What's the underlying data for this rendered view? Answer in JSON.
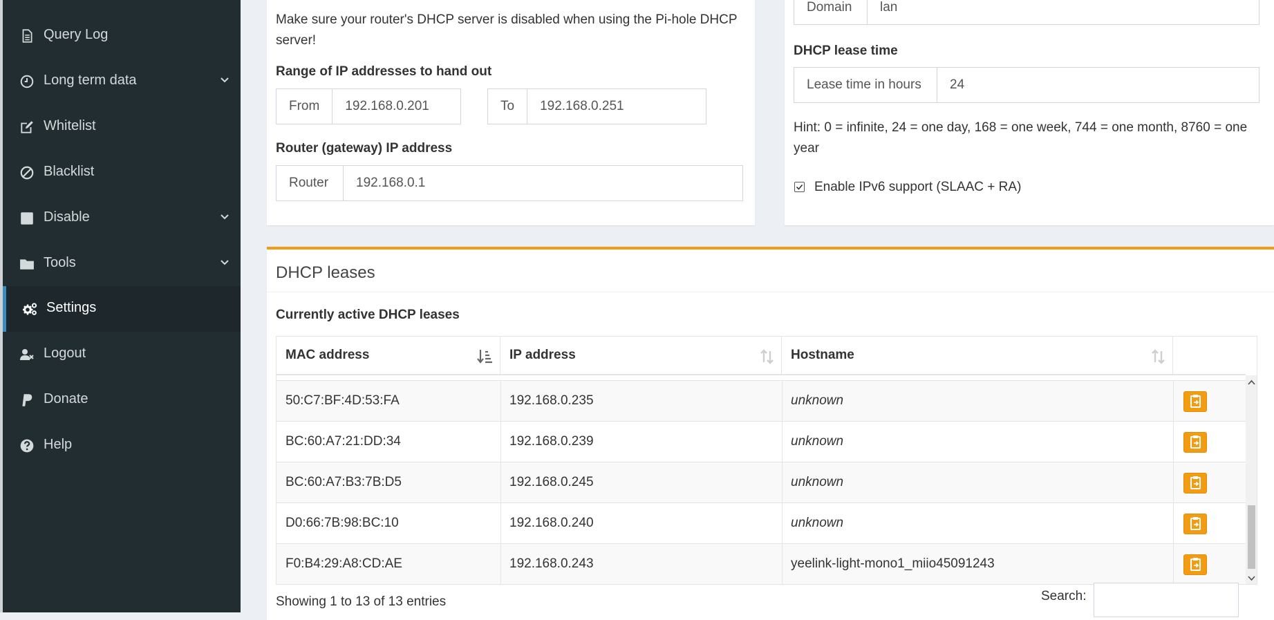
{
  "sidebar": {
    "items": [
      {
        "label": "Query Log",
        "icon": "file-text-icon",
        "active": false,
        "has_chevron": false
      },
      {
        "label": "Long term data",
        "icon": "clock-icon",
        "active": false,
        "has_chevron": true
      },
      {
        "label": "Whitelist",
        "icon": "edit-icon",
        "active": false,
        "has_chevron": false
      },
      {
        "label": "Blacklist",
        "icon": "ban-icon",
        "active": false,
        "has_chevron": false
      },
      {
        "label": "Disable",
        "icon": "stop-icon",
        "active": false,
        "has_chevron": true
      },
      {
        "label": "Tools",
        "icon": "folder-icon",
        "active": false,
        "has_chevron": true
      },
      {
        "label": "Settings",
        "icon": "gears-icon",
        "active": true,
        "has_chevron": false
      },
      {
        "label": "Logout",
        "icon": "user-times-icon",
        "active": false,
        "has_chevron": false
      },
      {
        "label": "Donate",
        "icon": "paypal-icon",
        "active": false,
        "has_chevron": false
      },
      {
        "label": "Help",
        "icon": "question-circle-icon",
        "active": false,
        "has_chevron": false
      }
    ]
  },
  "dhcp_settings": {
    "warning_line1": "Make sure your router's DHCP server is disabled when using the Pi-hole DHCP",
    "warning_line2": "server!",
    "range_heading": "Range of IP addresses to hand out",
    "from_label": "From",
    "from_value": "192.168.0.201",
    "to_label": "To",
    "to_value": "192.168.0.251",
    "router_heading": "Router (gateway) IP address",
    "router_label": "Router",
    "router_value": "192.168.0.1"
  },
  "dhcp_advanced": {
    "domain_label": "Domain",
    "domain_value": "lan",
    "lease_heading": "DHCP lease time",
    "lease_label": "Lease time in hours",
    "lease_value": "24",
    "hint_line1": "Hint: 0 = infinite, 24 = one day, 168 = one week, 744 = one month, 8760 = one",
    "hint_line2": "year",
    "ipv6_label": "Enable IPv6 support (SLAAC + RA)",
    "ipv6_checked": true
  },
  "leases": {
    "title": "DHCP leases",
    "subtitle": "Currently active DHCP leases",
    "columns": [
      "MAC address",
      "IP address",
      "Hostname"
    ],
    "rows": [
      {
        "mac": "50:C7:BF:4D:53:FA",
        "ip": "192.168.0.235",
        "hostname": "unknown",
        "unknown": true
      },
      {
        "mac": "BC:60:A7:21:DD:34",
        "ip": "192.168.0.239",
        "hostname": "unknown",
        "unknown": true
      },
      {
        "mac": "BC:60:A7:B3:7B:D5",
        "ip": "192.168.0.245",
        "hostname": "unknown",
        "unknown": true
      },
      {
        "mac": "D0:66:7B:98:BC:10",
        "ip": "192.168.0.240",
        "hostname": "unknown",
        "unknown": true
      },
      {
        "mac": "F0:B4:29:A8:CD:AE",
        "ip": "192.168.0.243",
        "hostname": "yeelink-light-mono1_miio45091243",
        "unknown": false
      }
    ],
    "info": "Showing 1 to 13 of 13 entries",
    "search_label": "Search:",
    "search_value": ""
  },
  "colors": {
    "accent": "#f39c12",
    "sidebar_bg": "#222d32",
    "active_border": "#3c8dbc"
  }
}
